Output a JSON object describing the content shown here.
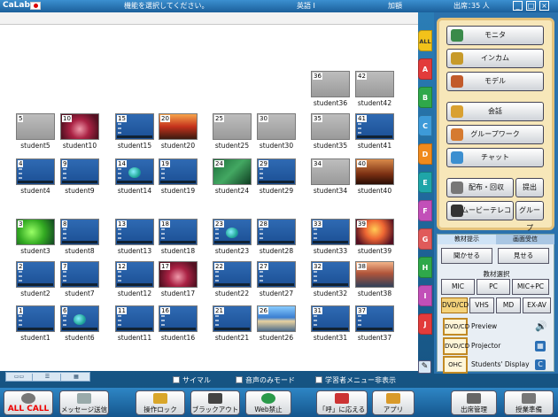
{
  "app": {
    "name": "CaLabo",
    "instruction": "機能を選択してください。",
    "course": "英語 I",
    "mode": "加額",
    "attendance_label": "出席：",
    "attendance_count": "35 人"
  },
  "window_controls": [
    "_",
    "□",
    "×"
  ],
  "students": [
    {
      "num": "36",
      "name": "student36",
      "state": "off"
    },
    {
      "num": "42",
      "name": "student42",
      "state": "off"
    },
    {
      "num": "5",
      "name": "student5",
      "state": "off"
    },
    {
      "num": "10",
      "name": "student10",
      "state": "img",
      "img": "flower"
    },
    {
      "num": "15",
      "name": "student15",
      "state": "blue"
    },
    {
      "num": "20",
      "name": "student20",
      "state": "img",
      "img": "sunset"
    },
    {
      "num": "25",
      "name": "student25",
      "state": "off"
    },
    {
      "num": "30",
      "name": "student30",
      "state": "off"
    },
    {
      "num": "35",
      "name": "student35",
      "state": "off"
    },
    {
      "num": "41",
      "name": "student41",
      "state": "blue"
    },
    {
      "num": "4",
      "name": "student4",
      "state": "blue"
    },
    {
      "num": "9",
      "name": "student9",
      "state": "blue"
    },
    {
      "num": "14",
      "name": "student14",
      "state": "win"
    },
    {
      "num": "19",
      "name": "student19",
      "state": "blue"
    },
    {
      "num": "24",
      "name": "student24",
      "state": "img",
      "img": "green"
    },
    {
      "num": "29",
      "name": "student29",
      "state": "blue"
    },
    {
      "num": "34",
      "name": "student34",
      "state": "off"
    },
    {
      "num": "40",
      "name": "student40",
      "state": "img",
      "img": "cave"
    },
    {
      "num": "3",
      "name": "student3",
      "state": "img",
      "img": "leaf"
    },
    {
      "num": "8",
      "name": "student8",
      "state": "blue"
    },
    {
      "num": "13",
      "name": "student13",
      "state": "blue"
    },
    {
      "num": "18",
      "name": "student18",
      "state": "blue"
    },
    {
      "num": "23",
      "name": "student23",
      "state": "win"
    },
    {
      "num": "28",
      "name": "student28",
      "state": "blue"
    },
    {
      "num": "33",
      "name": "student33",
      "state": "blue"
    },
    {
      "num": "39",
      "name": "student39",
      "state": "img",
      "img": "fire"
    },
    {
      "num": "2",
      "name": "student2",
      "state": "blue"
    },
    {
      "num": "7",
      "name": "student7",
      "state": "blue"
    },
    {
      "num": "12",
      "name": "student12",
      "state": "blue"
    },
    {
      "num": "17",
      "name": "student17",
      "state": "img",
      "img": "flower"
    },
    {
      "num": "22",
      "name": "student22",
      "state": "blue"
    },
    {
      "num": "27",
      "name": "student27",
      "state": "blue"
    },
    {
      "num": "32",
      "name": "student32",
      "state": "blue"
    },
    {
      "num": "38",
      "name": "student38",
      "state": "img",
      "img": "coast"
    },
    {
      "num": "1",
      "name": "student1",
      "state": "blue"
    },
    {
      "num": "6",
      "name": "student6",
      "state": "win"
    },
    {
      "num": "11",
      "name": "student11",
      "state": "blue"
    },
    {
      "num": "16",
      "name": "student16",
      "state": "blue"
    },
    {
      "num": "21",
      "name": "student21",
      "state": "blue"
    },
    {
      "num": "26",
      "name": "student26",
      "state": "img",
      "img": "beach"
    },
    {
      "num": "31",
      "name": "student31",
      "state": "blue"
    },
    {
      "num": "37",
      "name": "student37",
      "state": "blue"
    }
  ],
  "groups": [
    {
      "label": "ALL",
      "color": "#f2c21a"
    },
    {
      "label": "A",
      "color": "#e23b3b"
    },
    {
      "label": "B",
      "color": "#2fa84a"
    },
    {
      "label": "C",
      "color": "#3d9ad8"
    },
    {
      "label": "D",
      "color": "#f08a1c"
    },
    {
      "label": "E",
      "color": "#1fa5a8"
    },
    {
      "label": "F",
      "color": "#c24fb8"
    },
    {
      "label": "G",
      "color": "#e05a5a"
    },
    {
      "label": "H",
      "color": "#2fa84a"
    },
    {
      "label": "I",
      "color": "#c24fb8"
    },
    {
      "label": "J",
      "color": "#e23b3b"
    }
  ],
  "view_tabs": [
    "▭▭",
    "☰",
    "▦"
  ],
  "options": [
    "サイマル",
    "音声のみモード",
    "学習者メニュー非表示"
  ],
  "bottom_buttons": [
    "ALL CALL",
    "メッセージ送信",
    "操作ロック",
    "ブラックアウト",
    "Web禁止",
    "「呼」に応える",
    "アプリ",
    "出席管理",
    "授業準備"
  ],
  "right_buttons": {
    "monitor": "モニタ",
    "intercom": "インカム",
    "model": "モデル",
    "conversation": "会話",
    "groupwork": "グループワーク",
    "chat": "チャット",
    "distribute": "配布・回収",
    "submit": "提出",
    "movie": "ムービーテレコ",
    "group": "グループ"
  },
  "lower_panel": {
    "tabs": [
      "教材提示",
      "画面受信"
    ],
    "listen": "聞かせる",
    "show": "見せる",
    "material_select": "教材選択",
    "materials": [
      "MIC",
      "PC",
      "MIC+PC",
      "DVD/CD",
      "VHS",
      "MD",
      "EX-AV"
    ],
    "devices": [
      {
        "box": "DVD/CD",
        "label": "Preview",
        "icon": "speaker-icon"
      },
      {
        "box": "DVD/CD",
        "label": "Projector",
        "icon": "projector-icon"
      },
      {
        "box": "OHC",
        "label": "Students' Display",
        "icon": "display-icon"
      }
    ]
  }
}
